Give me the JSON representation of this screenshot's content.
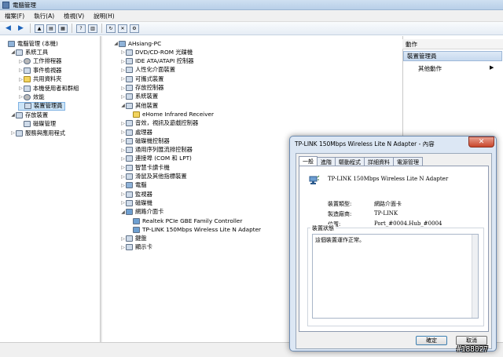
{
  "window": {
    "title": "電腦管理"
  },
  "menu": [
    "檔案(F)",
    "執行(A)",
    "檢視(V)",
    "說明(H)"
  ],
  "left_tree": [
    {
      "label": "電腦管理 (本機)",
      "indent": 0,
      "icon": "computer-icon",
      "expander": ""
    },
    {
      "label": "系統工具",
      "indent": 1,
      "icon": "tools-icon",
      "expander": "◢"
    },
    {
      "label": "工作排程器",
      "indent": 2,
      "icon": "clock-icon",
      "expander": "▷"
    },
    {
      "label": "事件檢視器",
      "indent": 2,
      "icon": "event-viewer-icon",
      "expander": "▷"
    },
    {
      "label": "共用資料夾",
      "indent": 2,
      "icon": "shared-folder-icon",
      "expander": "▷"
    },
    {
      "label": "本機使用者和群組",
      "indent": 2,
      "icon": "users-icon",
      "expander": "▷"
    },
    {
      "label": "效能",
      "indent": 2,
      "icon": "performance-icon",
      "expander": "▷"
    },
    {
      "label": "裝置管理員",
      "indent": 2,
      "icon": "device-manager-icon",
      "expander": "",
      "selected": true
    },
    {
      "label": "存放裝置",
      "indent": 1,
      "icon": "storage-icon",
      "expander": "◢"
    },
    {
      "label": "磁碟管理",
      "indent": 2,
      "icon": "disk-icon",
      "expander": ""
    },
    {
      "label": "服務與應用程式",
      "indent": 1,
      "icon": "services-icon",
      "expander": "▷"
    }
  ],
  "device_tree": [
    {
      "label": "AHsiang-PC",
      "indent": 0,
      "expander": "◢",
      "icon": "computer-icon"
    },
    {
      "label": "DVD/CD-ROM 光碟機",
      "indent": 1,
      "expander": "▷",
      "icon": "dvd-icon"
    },
    {
      "label": "IDE ATA/ATAPI 控制器",
      "indent": 1,
      "expander": "▷",
      "icon": "ide-icon"
    },
    {
      "label": "人性化介面裝置",
      "indent": 1,
      "expander": "▷",
      "icon": "hid-icon"
    },
    {
      "label": "可攜式裝置",
      "indent": 1,
      "expander": "▷",
      "icon": "portable-icon"
    },
    {
      "label": "存放控制器",
      "indent": 1,
      "expander": "▷",
      "icon": "storage-controller-icon"
    },
    {
      "label": "系統裝置",
      "indent": 1,
      "expander": "▷",
      "icon": "system-device-icon"
    },
    {
      "label": "其他裝置",
      "indent": 1,
      "expander": "◢",
      "icon": "other-device-icon"
    },
    {
      "label": "eHome Infrared Receiver",
      "indent": 2,
      "expander": "",
      "icon": "warning-device-icon"
    },
    {
      "label": "音效，視訊及遊戲控制器",
      "indent": 1,
      "expander": "▷",
      "icon": "sound-icon"
    },
    {
      "label": "處理器",
      "indent": 1,
      "expander": "▷",
      "icon": "cpu-icon"
    },
    {
      "label": "磁碟機控制器",
      "indent": 1,
      "expander": "▷",
      "icon": "disk-controller-icon"
    },
    {
      "label": "通用序列匯流排控制器",
      "indent": 1,
      "expander": "▷",
      "icon": "usb-icon"
    },
    {
      "label": "連接埠 (COM 和 LPT)",
      "indent": 1,
      "expander": "▷",
      "icon": "port-icon"
    },
    {
      "label": "智慧卡讀卡機",
      "indent": 1,
      "expander": "▷",
      "icon": "smartcard-icon"
    },
    {
      "label": "滑鼠及其他指標裝置",
      "indent": 1,
      "expander": "▷",
      "icon": "mouse-icon"
    },
    {
      "label": "電腦",
      "indent": 1,
      "expander": "▷",
      "icon": "computer-icon"
    },
    {
      "label": "監視器",
      "indent": 1,
      "expander": "▷",
      "icon": "monitor-icon"
    },
    {
      "label": "磁碟機",
      "indent": 1,
      "expander": "▷",
      "icon": "disk-drive-icon"
    },
    {
      "label": "網路介面卡",
      "indent": 1,
      "expander": "◢",
      "icon": "network-icon"
    },
    {
      "label": "Realtek PCIe GBE Family Controller",
      "indent": 2,
      "expander": "",
      "icon": "network-adapter-icon"
    },
    {
      "label": "TP-LINK 150Mbps Wireless Lite N Adapter",
      "indent": 2,
      "expander": "",
      "icon": "network-adapter-icon"
    },
    {
      "label": "鍵盤",
      "indent": 1,
      "expander": "▷",
      "icon": "keyboard-icon"
    },
    {
      "label": "顯示卡",
      "indent": 1,
      "expander": "▷",
      "icon": "display-adapter-icon"
    }
  ],
  "actions": {
    "header": "動作",
    "section": "裝置管理員",
    "item": "其他動作"
  },
  "dialog": {
    "title": "TP-LINK 150Mbps Wireless Lite N Adapter - 內容",
    "close": "✕",
    "tabs": [
      "一般",
      "進階",
      "驅動程式",
      "詳細資料",
      "電源管理"
    ],
    "device_name": "TP-LINK 150Mbps Wireless Lite N Adapter",
    "props": [
      {
        "label": "裝置類型:",
        "value": "網路介面卡"
      },
      {
        "label": "製造廠商:",
        "value": "TP-LINK"
      },
      {
        "label": "位置:",
        "value": "Port_#0004.Hub_#0004"
      }
    ],
    "status_group": "裝置狀態",
    "status_text": "這個裝置運作正常。",
    "ok": "確定",
    "cancel": "取消"
  },
  "watermark": "#188027"
}
